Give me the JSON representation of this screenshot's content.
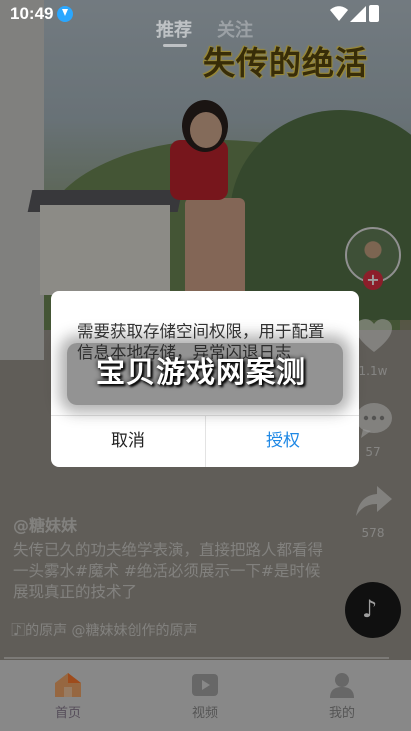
{
  "status_bar": {
    "time": "10:49"
  },
  "top_tabs": [
    {
      "label": "推荐"
    },
    {
      "label": "关注"
    }
  ],
  "video": {
    "overlay_title": "失传的绝活",
    "author": "@糖妹妹",
    "caption": "失传已久的功夫绝学表演，直接把路人都看得一头雾水#魔术 #绝活必须展示一下#是时候展现真正的技术了",
    "music": "♪ ⃞的原声   @糖妹妹创作的原声",
    "like_count": "1.1w",
    "comment_count": "57",
    "share_count": "578"
  },
  "dialog": {
    "message": "需要获取存储空间权限，用于配置信息本地存储，异常闪退日志",
    "cancel_label": "取消",
    "grant_label": "授权"
  },
  "watermark": "宝贝游戏网案测",
  "bottom_nav": [
    {
      "label": "首页"
    },
    {
      "label": "视频"
    },
    {
      "label": "我的"
    }
  ],
  "colors": {
    "accent": "#1e88e5",
    "follow": "#e33145",
    "home_icon": "#ff7a2e"
  }
}
